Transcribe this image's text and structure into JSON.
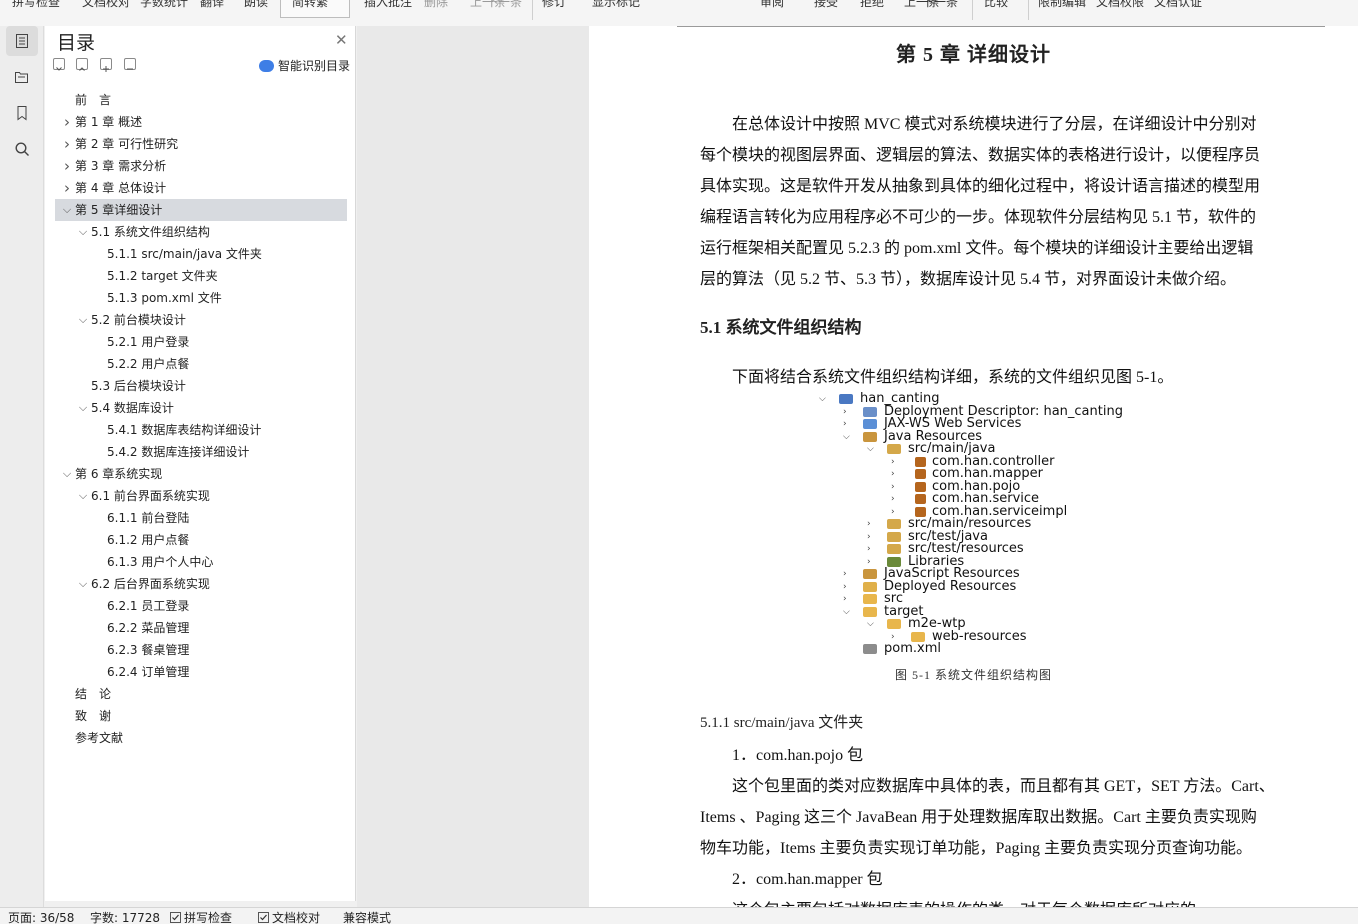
{
  "toolbar": {
    "items": [
      "拼写检查",
      "文档校对",
      "字数统计",
      "翻译",
      "朗读",
      "简转繁",
      "插入批注",
      "删除",
      "上一条",
      "下一条",
      "修订",
      "显示标记",
      "审阅",
      "接受",
      "拒绝",
      "上一条",
      "下一条",
      "比较",
      "限制编辑",
      "文档权限",
      "文档认证"
    ]
  },
  "outline": {
    "title": "目录",
    "smart_label": "智能识别目录",
    "items": [
      {
        "label": "前　言",
        "level": 0,
        "arrow": ""
      },
      {
        "label": "第 1 章  概述",
        "level": 0,
        "arrow": "›"
      },
      {
        "label": "第 2 章  可行性研究",
        "level": 0,
        "arrow": "›"
      },
      {
        "label": "第 3 章  需求分析",
        "level": 0,
        "arrow": "›"
      },
      {
        "label": "第 4 章  总体设计",
        "level": 0,
        "arrow": "›"
      },
      {
        "label": "第 5 章详细设计",
        "level": 0,
        "arrow": "⌄",
        "selected": true
      },
      {
        "label": "5.1  系统文件组织结构",
        "level": 1,
        "arrow": "⌄"
      },
      {
        "label": "5.1.1 src/main/java 文件夹",
        "level": 2,
        "arrow": ""
      },
      {
        "label": "5.1.2 target 文件夹",
        "level": 2,
        "arrow": ""
      },
      {
        "label": "5.1.3 pom.xml 文件",
        "level": 2,
        "arrow": ""
      },
      {
        "label": "5.2  前台模块设计",
        "level": 1,
        "arrow": "⌄"
      },
      {
        "label": "5.2.1  用户登录",
        "level": 2,
        "arrow": ""
      },
      {
        "label": "5.2.2  用户点餐",
        "level": 2,
        "arrow": ""
      },
      {
        "label": "5.3  后台模块设计",
        "level": 1,
        "arrow": ""
      },
      {
        "label": "5.4  数据库设计",
        "level": 1,
        "arrow": "⌄"
      },
      {
        "label": "5.4.1  数据库表结构详细设计",
        "level": 2,
        "arrow": ""
      },
      {
        "label": "5.4.2  数据库连接详细设计",
        "level": 2,
        "arrow": ""
      },
      {
        "label": "第 6 章系统实现",
        "level": 0,
        "arrow": "⌄"
      },
      {
        "label": "6.1  前台界面系统实现",
        "level": 1,
        "arrow": "⌄"
      },
      {
        "label": "6.1.1  前台登陆",
        "level": 2,
        "arrow": ""
      },
      {
        "label": "6.1.2  用户点餐",
        "level": 2,
        "arrow": ""
      },
      {
        "label": "6.1.3  用户个人中心",
        "level": 2,
        "arrow": ""
      },
      {
        "label": "6.2  后台界面系统实现",
        "level": 1,
        "arrow": "⌄"
      },
      {
        "label": "6.2.1  员工登录",
        "level": 2,
        "arrow": ""
      },
      {
        "label": "6.2.2  菜品管理",
        "level": 2,
        "arrow": ""
      },
      {
        "label": "6.2.3  餐桌管理",
        "level": 2,
        "arrow": ""
      },
      {
        "label": "6.2.4  订单管理",
        "level": 2,
        "arrow": ""
      },
      {
        "label": "结　论",
        "level": 0,
        "arrow": ""
      },
      {
        "label": "致　谢",
        "level": 0,
        "arrow": ""
      },
      {
        "label": "参考文献",
        "level": 0,
        "arrow": ""
      }
    ]
  },
  "document": {
    "chapter_title": "第 5 章  详细设计",
    "intro_lines": [
      "　　在总体设计中按照 MVC 模式对系统模块进行了分层，在详细设计中分别对",
      "每个模块的视图层界面、逻辑层的算法、数据实体的表格进行设计，以便程序员",
      "具体实现。这是软件开发从抽象到具体的细化过程中，将设计语言描述的模型用",
      "编程语言转化为应用程序必不可少的一步。体现软件分层结构见 5.1 节，软件的",
      "运行框架相关配置见 5.2.3 的 pom.xml 文件。每个模块的详细设计主要给出逻辑",
      "层的算法（见 5.2 节、5.3 节），数据库设计见 5.4 节，对界面设计未做介绍。"
    ],
    "section_51": "5.1  系统文件组织结构",
    "section_51_text": "　　下面将结合系统文件组织结构详细，系统的文件组织见图 5-1。",
    "figure_caption": "图 5-1  系统文件组织结构图",
    "section_511": "5.1.1 src/main/java 文件夹",
    "item1": "　　1．com.han.pojo 包",
    "item1_lines": [
      "　　这个包里面的类对应数据库中具体的表，而且都有其 GET，SET 方法。Cart、",
      "Items  、Paging 这三个 JavaBean 用于处理数据库取出数据。Cart 主要负责实现购",
      "物车功能，Items 主要负责实现订单功能，Paging 主要负责实现分页查询功能。"
    ],
    "item2": "　　2．com.han.mapper 包",
    "item2_partial": "　　这个包主要包括对数据库表的操作的类，对于每个数据库所对应的"
  },
  "project_tree": [
    {
      "text": "han_canting",
      "depth": 0,
      "arrow": "⌄",
      "icon": "project-icon"
    },
    {
      "text": "Deployment Descriptor: han_canting",
      "depth": 1,
      "arrow": "›",
      "icon": "descriptor-icon"
    },
    {
      "text": "JAX-WS Web Services",
      "depth": 1,
      "arrow": "›",
      "icon": "webservice-icon"
    },
    {
      "text": "Java Resources",
      "depth": 1,
      "arrow": "⌄",
      "icon": "java-resources-icon"
    },
    {
      "text": "src/main/java",
      "depth": 2,
      "arrow": "⌄",
      "icon": "source-folder-icon"
    },
    {
      "text": "com.han.controller",
      "depth": 3,
      "arrow": "›",
      "icon": "package-icon"
    },
    {
      "text": "com.han.mapper",
      "depth": 3,
      "arrow": "›",
      "icon": "package-icon"
    },
    {
      "text": "com.han.pojo",
      "depth": 3,
      "arrow": "›",
      "icon": "package-icon"
    },
    {
      "text": "com.han.service",
      "depth": 3,
      "arrow": "›",
      "icon": "package-icon"
    },
    {
      "text": "com.han.serviceimpl",
      "depth": 3,
      "arrow": "›",
      "icon": "package-icon"
    },
    {
      "text": "src/main/resources",
      "depth": 2,
      "arrow": "›",
      "icon": "source-folder-icon"
    },
    {
      "text": "src/test/java",
      "depth": 2,
      "arrow": "›",
      "icon": "source-folder-icon"
    },
    {
      "text": "src/test/resources",
      "depth": 2,
      "arrow": "›",
      "icon": "source-folder-icon"
    },
    {
      "text": "Libraries",
      "depth": 2,
      "arrow": "›",
      "icon": "library-icon"
    },
    {
      "text": "JavaScript Resources",
      "depth": 1,
      "arrow": "›",
      "icon": "js-resources-icon"
    },
    {
      "text": "Deployed Resources",
      "depth": 1,
      "arrow": "›",
      "icon": "deployed-icon"
    },
    {
      "text": "src",
      "depth": 1,
      "arrow": "›",
      "icon": "folder-icon"
    },
    {
      "text": "target",
      "depth": 1,
      "arrow": "⌄",
      "icon": "folder-icon"
    },
    {
      "text": "m2e-wtp",
      "depth": 2,
      "arrow": "⌄",
      "icon": "folder-icon"
    },
    {
      "text": "web-resources",
      "depth": 3,
      "arrow": "›",
      "icon": "folder-icon"
    },
    {
      "text": "pom.xml",
      "depth": 1,
      "arrow": "",
      "icon": "xml-file-icon"
    }
  ],
  "status": {
    "page": "页面: 36/58",
    "words": "字数: 17728",
    "spell": "拼写检查",
    "proof": "文档校对",
    "compat": "兼容模式"
  },
  "colors": {
    "selected_row": "#d7dadf",
    "smart_icon": "#3e7ee6",
    "package_icon": "#b5651d",
    "folder_icon": "#e8b64c"
  }
}
